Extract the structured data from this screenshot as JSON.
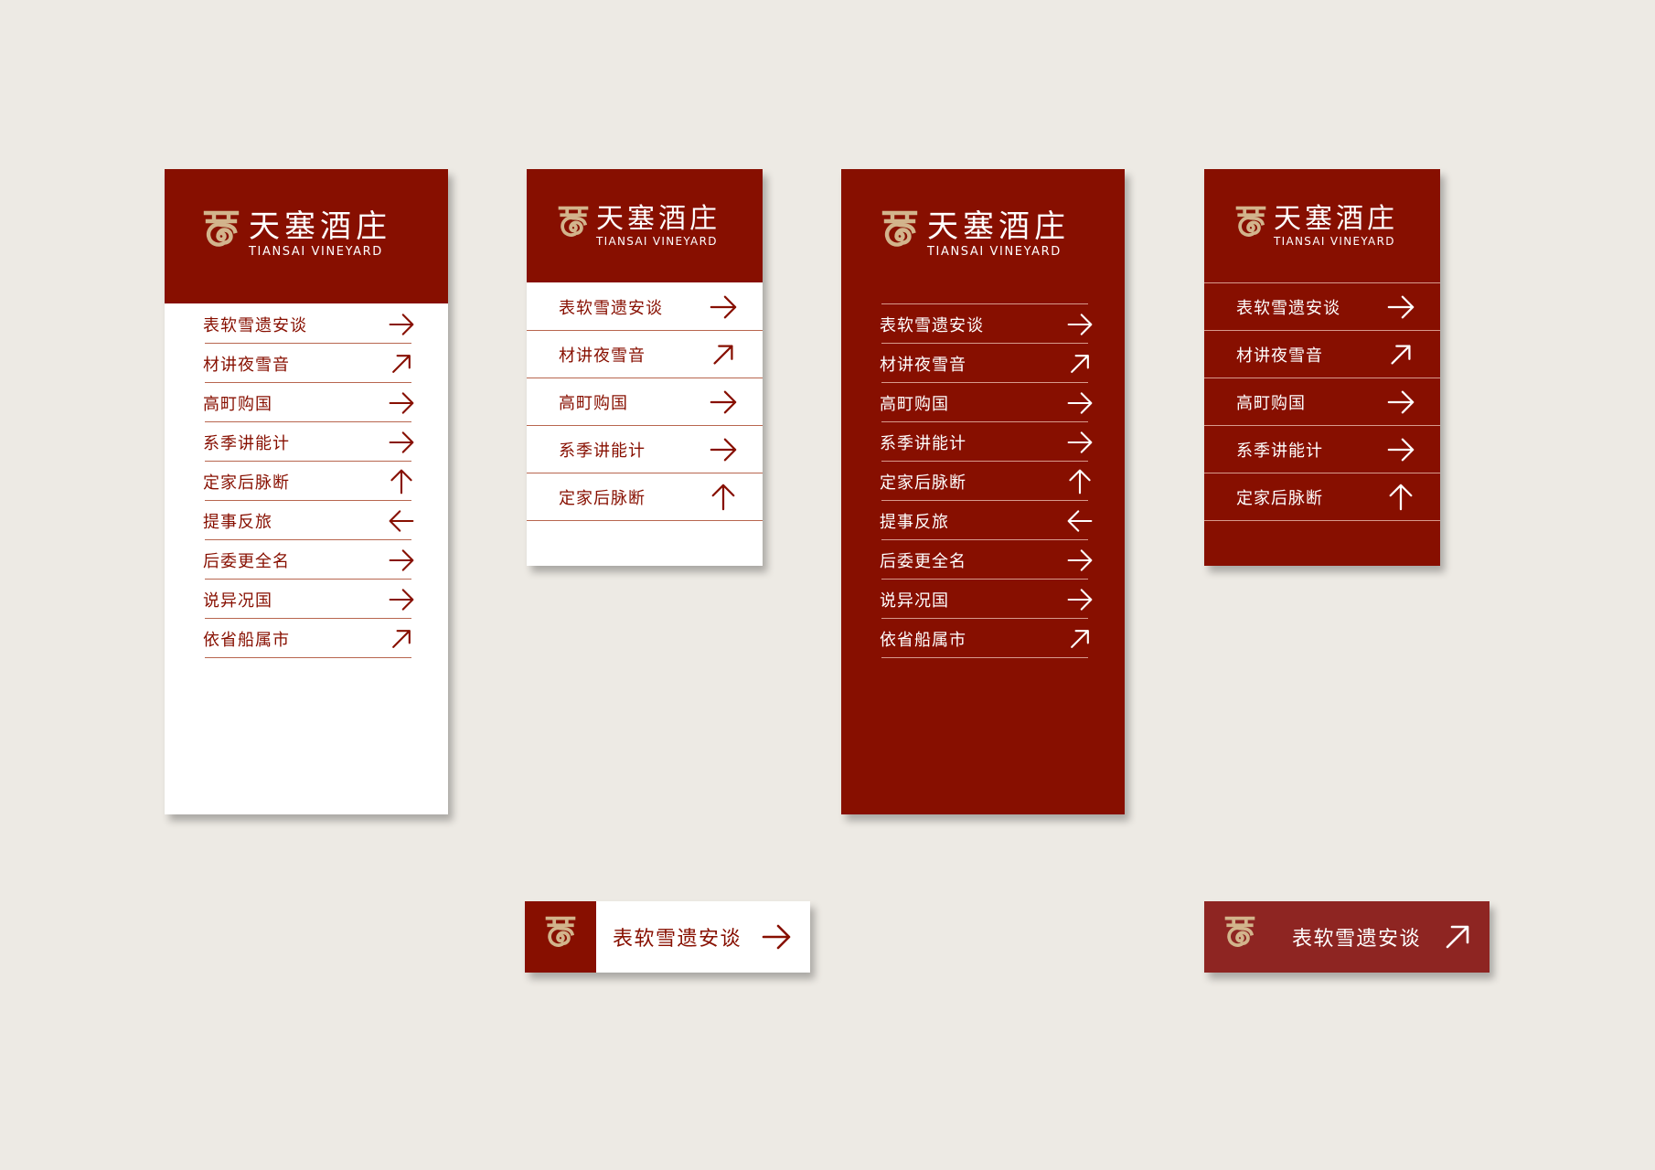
{
  "brand": {
    "name_cn": "天塞酒庄",
    "name_en": "TIANSAI VINEYARD",
    "colors": {
      "primary_red": "#870f00",
      "gold": "#d2b48c",
      "white": "#ffffff",
      "background": "#edeae4"
    },
    "logo_icon": "spiral-seal-icon"
  },
  "signs": {
    "tall_white": {
      "rows": [
        {
          "label": "表软雪遗安谈",
          "arrow": "right"
        },
        {
          "label": "材讲夜雪音",
          "arrow": "up-right"
        },
        {
          "label": "高町购国",
          "arrow": "right"
        },
        {
          "label": "系季讲能计",
          "arrow": "right"
        },
        {
          "label": "定家后脉断",
          "arrow": "up"
        },
        {
          "label": "提事反旅",
          "arrow": "left"
        },
        {
          "label": "后委更全名",
          "arrow": "right"
        },
        {
          "label": "说异况国",
          "arrow": "right"
        },
        {
          "label": "依省船属市",
          "arrow": "up-right"
        }
      ]
    },
    "short_white": {
      "rows": [
        {
          "label": "表软雪遗安谈",
          "arrow": "right"
        },
        {
          "label": "材讲夜雪音",
          "arrow": "up-right"
        },
        {
          "label": "高町购国",
          "arrow": "right"
        },
        {
          "label": "系季讲能计",
          "arrow": "right"
        },
        {
          "label": "定家后脉断",
          "arrow": "up"
        }
      ]
    },
    "tall_red": {
      "rows": [
        {
          "label": "表软雪遗安谈",
          "arrow": "right"
        },
        {
          "label": "材讲夜雪音",
          "arrow": "up-right"
        },
        {
          "label": "高町购国",
          "arrow": "right"
        },
        {
          "label": "系季讲能计",
          "arrow": "right"
        },
        {
          "label": "定家后脉断",
          "arrow": "up"
        },
        {
          "label": "提事反旅",
          "arrow": "left"
        },
        {
          "label": "后委更全名",
          "arrow": "right"
        },
        {
          "label": "说异况国",
          "arrow": "right"
        },
        {
          "label": "依省船属市",
          "arrow": "up-right"
        }
      ]
    },
    "short_red": {
      "rows": [
        {
          "label": "表软雪遗安谈",
          "arrow": "right"
        },
        {
          "label": "材讲夜雪音",
          "arrow": "up-right"
        },
        {
          "label": "高町购国",
          "arrow": "right"
        },
        {
          "label": "系季讲能计",
          "arrow": "right"
        },
        {
          "label": "定家后脉断",
          "arrow": "up"
        }
      ]
    },
    "band_white": {
      "label": "表软雪遗安谈",
      "arrow": "right"
    },
    "band_red": {
      "label": "表软雪遗安谈",
      "arrow": "up-right"
    }
  }
}
